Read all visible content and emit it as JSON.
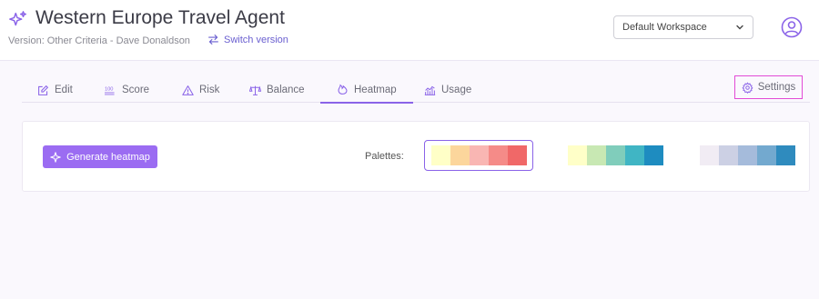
{
  "header": {
    "title": "Western Europe Travel Agent",
    "version_text": "Version: Other Criteria - Dave Donaldson",
    "switch_version_label": "Switch version",
    "workspace_selected": "Default Workspace"
  },
  "tabs": [
    {
      "label": "Edit",
      "icon": "edit-icon"
    },
    {
      "label": "Score",
      "icon": "score-icon"
    },
    {
      "label": "Risk",
      "icon": "warning-icon"
    },
    {
      "label": "Balance",
      "icon": "balance-scale-icon"
    },
    {
      "label": "Heatmap",
      "icon": "heatmap-icon",
      "active": true
    },
    {
      "label": "Usage",
      "icon": "usage-chart-icon"
    }
  ],
  "settings_label": "Settings",
  "heatmap": {
    "generate_label": "Generate heatmap",
    "palettes_label": "Palettes:",
    "palettes": [
      {
        "selected": true,
        "colors": [
          "#ffffc7",
          "#fcd69c",
          "#f9b6b3",
          "#f58b88",
          "#f06868"
        ]
      },
      {
        "selected": false,
        "colors": [
          "#ffffc8",
          "#c8e8b3",
          "#80cdbb",
          "#40b5c4",
          "#1e8cc0"
        ]
      },
      {
        "selected": false,
        "colors": [
          "#f1ecf4",
          "#ccd0e4",
          "#a5bbdb",
          "#73a9cf",
          "#2f8bbe"
        ]
      }
    ]
  },
  "colors": {
    "accent": "#9b6cf2",
    "selected_border": "#8a63e8",
    "settings_highlight": "#e24bd6"
  }
}
